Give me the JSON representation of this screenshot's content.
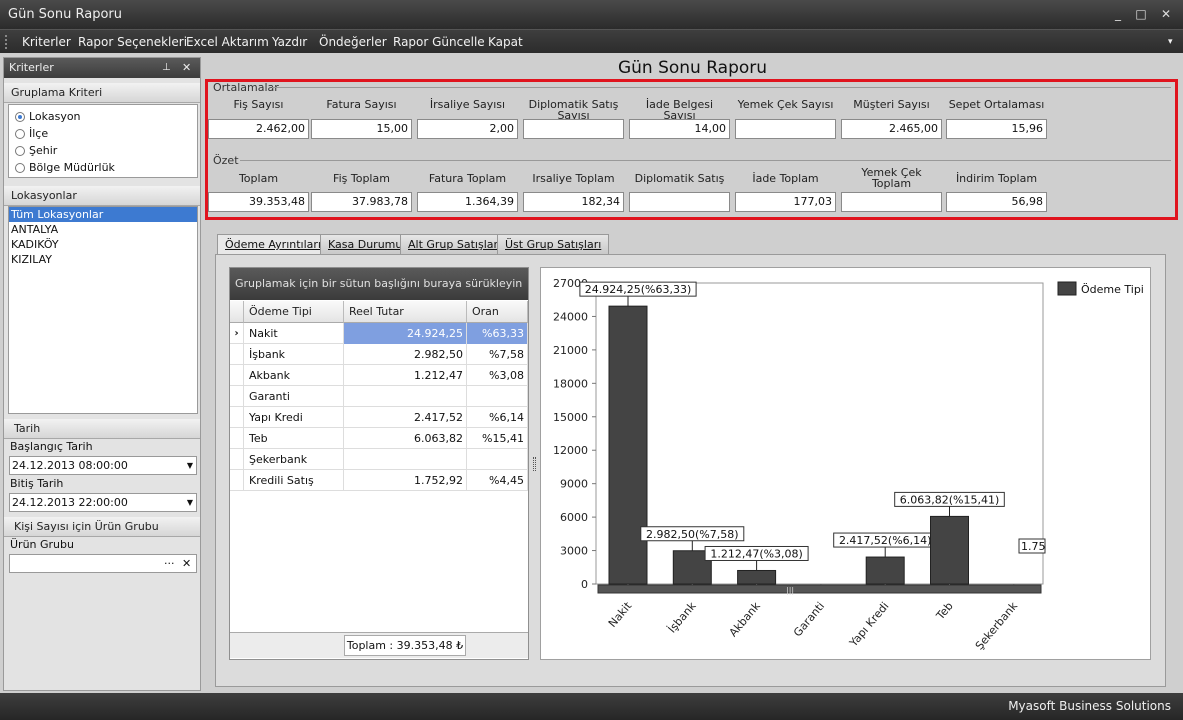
{
  "window": {
    "title": "Gün Sonu Raporu",
    "controls": [
      "_",
      "□",
      "✕"
    ]
  },
  "menu": {
    "items": [
      "Kriterler",
      "Rapor Seçenekleri",
      "Excel Aktarım",
      "Yazdır",
      "Öndeğerler",
      "Rapor Güncelle",
      "Kapat"
    ],
    "overflow": "▾"
  },
  "left": {
    "panel_title": "Kriterler",
    "grouping": {
      "title": "Gruplama Kriteri",
      "options": [
        "Lokasyon",
        "İlçe",
        "Şehir",
        "Bölge Müdürlük"
      ],
      "selected": 0
    },
    "locations": {
      "title": "Lokasyonlar",
      "items": [
        "Tüm Lokasyonlar",
        "ANTALYA",
        "KADIKÖY",
        "KIZILAY"
      ],
      "selected": 0
    },
    "date": {
      "title": "Tarih",
      "start_label": "Başlangıç Tarih",
      "start_value": "24.12.2013 08:00:00",
      "end_label": "Bitiş Tarih",
      "end_value": "24.12.2013 22:00:00"
    },
    "product": {
      "title": "Kişi Sayısı için Ürün Grubu",
      "label": "Ürün Grubu",
      "value": "",
      "ellipsis": "···",
      "clear": "✕"
    }
  },
  "page_title": "Gün Sonu Raporu",
  "averages": {
    "title": "Ortalamalar",
    "fields": [
      {
        "label": "Fiş Sayısı",
        "value": "2.462,00"
      },
      {
        "label": "Fatura Sayısı",
        "value": "15,00"
      },
      {
        "label": "İrsaliye Sayısı",
        "value": "2,00"
      },
      {
        "label": "Diplomatik Satış Sayısı",
        "value": ""
      },
      {
        "label": "İade Belgesi Sayısı",
        "value": "14,00"
      },
      {
        "label": "Yemek Çek Sayısı",
        "value": ""
      },
      {
        "label": "Müşteri Sayısı",
        "value": "2.465,00"
      },
      {
        "label": "Sepet Ortalaması",
        "value": "15,96"
      }
    ]
  },
  "summary": {
    "title": "Özet",
    "fields": [
      {
        "label": "Toplam",
        "value": "39.353,48"
      },
      {
        "label": "Fiş Toplam",
        "value": "37.983,78"
      },
      {
        "label": "Fatura Toplam",
        "value": "1.364,39"
      },
      {
        "label": "Irsaliye Toplam",
        "value": "182,34"
      },
      {
        "label": "Diplomatik Satış",
        "value": ""
      },
      {
        "label": "İade Toplam",
        "value": "177,03"
      },
      {
        "label": "Yemek Çek Toplam",
        "value": ""
      },
      {
        "label": "İndirim Toplam",
        "value": "56,98"
      }
    ]
  },
  "tabs": [
    "Ödeme Ayrıntıları",
    "Kasa Durumu",
    "Alt Grup Satışları",
    "Üst Grup Satışları"
  ],
  "grid": {
    "group_hint": "Gruplamak için bir sütun başlığını buraya sürükleyin",
    "columns": [
      "Ödeme Tipi",
      "Reel Tutar",
      "Oran"
    ],
    "rows": [
      {
        "type": "Nakit",
        "amount": "24.924,25",
        "ratio": "%63,33"
      },
      {
        "type": "İşbank",
        "amount": "2.982,50",
        "ratio": "%7,58"
      },
      {
        "type": "Akbank",
        "amount": "1.212,47",
        "ratio": "%3,08"
      },
      {
        "type": "Garanti",
        "amount": "",
        "ratio": ""
      },
      {
        "type": "Yapı Kredi",
        "amount": "2.417,52",
        "ratio": "%6,14"
      },
      {
        "type": "Teb",
        "amount": "6.063,82",
        "ratio": "%15,41"
      },
      {
        "type": "Şekerbank",
        "amount": "",
        "ratio": ""
      },
      {
        "type": "Kredili Satış",
        "amount": "1.752,92",
        "ratio": "%4,45"
      }
    ],
    "footer": "Toplam : 39.353,48 ₺"
  },
  "chart_data": {
    "type": "bar",
    "categories": [
      "Nakit",
      "İşbank",
      "Akbank",
      "Garanti",
      "Yapı Kredi",
      "Teb",
      "Şekerbank"
    ],
    "values": [
      24924.25,
      2982.5,
      1212.47,
      0,
      2417.52,
      6063.82,
      0
    ],
    "labels": [
      "24.924,25(%63,33)",
      "2.982,50(%7,58)",
      "1.212,47(%3,08)",
      "",
      "2.417,52(%6,14)",
      "6.063,82(%15,41)",
      ""
    ],
    "clipped_label": "1.75",
    "yticks": [
      "0",
      "3000",
      "6000",
      "9000",
      "12000",
      "15000",
      "18000",
      "21000",
      "24000",
      "27000"
    ],
    "ylim": [
      0,
      27000
    ],
    "legend": "Ödeme Tipi",
    "legend_position": "top-right",
    "bar_color": "#444444",
    "grid": false
  },
  "status": {
    "text": "Myasoft Business Solutions"
  },
  "colors": {
    "highlight": "#e0141e",
    "selection": "#7f9fe0"
  }
}
